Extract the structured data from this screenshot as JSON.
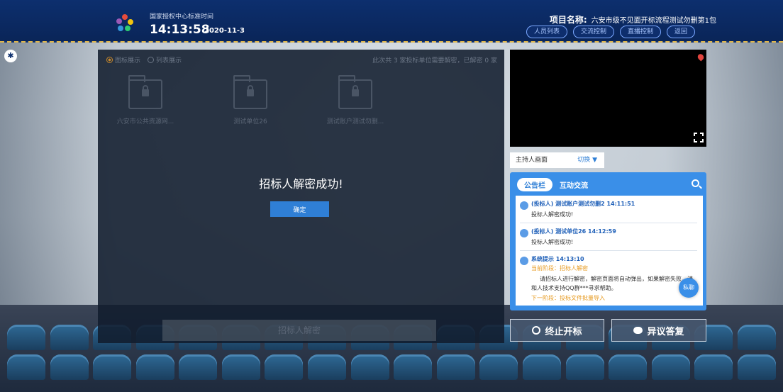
{
  "header": {
    "clock_title": "国家授权中心标准时间",
    "time": "14:13:58",
    "date": "2020-11-3",
    "project_label": "项目名称:",
    "project_name": "六安市级不见面开标流程测试勿删第1包",
    "nav": [
      "人员列表",
      "交流控制",
      "直播控制",
      "返回"
    ]
  },
  "main": {
    "view_options": [
      "图标展示",
      "列表展示"
    ],
    "count_info": "此次共 3 家投标单位需要解密，已解密 0 家",
    "files": [
      {
        "name": "六安市公共资源网..."
      },
      {
        "name": "测试单位26"
      },
      {
        "name": "测试账户测试勿删..."
      }
    ],
    "dialog_message": "招标人解密成功!",
    "confirm_label": "确定",
    "decrypt_label": "招标人解密"
  },
  "video": {
    "host_label": "主持人画面",
    "switch_label": "切换 ▼"
  },
  "board": {
    "tab_active": "公告栏",
    "tab_other": "互动交流",
    "messages": [
      {
        "head": "(投标人) 测试账户测试勿删2 14:11:51",
        "body": "投标人解密成功!"
      },
      {
        "head": "(投标人) 测试单位26 14:12:59",
        "body": "投标人解密成功!"
      }
    ],
    "system": {
      "head": "系统提示 14:13:10",
      "stage": "当前阶段：招标人解密",
      "body": "请招标人进行解密，解密页面将自动弹出，如果解密失败，请和人技术支持QQ群***寻求帮助。",
      "next": "下一阶段：投标文件批量导入"
    },
    "private_chat": "私聊"
  },
  "actions": {
    "stop": "终止开标",
    "objection": "异议答复"
  },
  "colors": {
    "header_bg": "#0d2f6e",
    "accent": "#2f7fd6",
    "stage": "#e79a1f"
  }
}
